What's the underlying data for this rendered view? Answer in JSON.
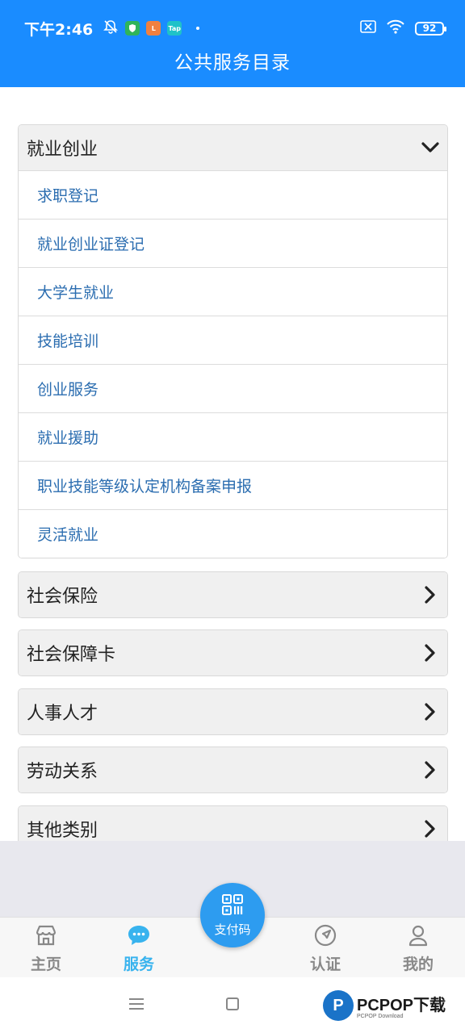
{
  "status_bar": {
    "time": "下午2:46",
    "battery": "92",
    "app_badge_1": "L",
    "app_badge_2": "Tap"
  },
  "header": {
    "title": "公共服务目录"
  },
  "sections": [
    {
      "title": "就业创业",
      "expanded": true,
      "items": [
        "求职登记",
        "就业创业证登记",
        "大学生就业",
        "技能培训",
        "创业服务",
        "就业援助",
        "职业技能等级认定机构备案申报",
        "灵活就业"
      ]
    },
    {
      "title": "社会保险",
      "expanded": false
    },
    {
      "title": "社会保障卡",
      "expanded": false
    },
    {
      "title": "人事人才",
      "expanded": false
    },
    {
      "title": "劳动关系",
      "expanded": false
    },
    {
      "title": "其他类别",
      "expanded": false
    }
  ],
  "tabbar": {
    "home": "主页",
    "service": "服务",
    "pay": "支付码",
    "auth": "认证",
    "mine": "我的"
  },
  "watermark": {
    "main": "PCPOP下载",
    "sub": "PCPOP Download"
  },
  "colors": {
    "header_bg": "#1a8cff",
    "link_text": "#2b6db0",
    "active_tab": "#38b3ee",
    "pay_button": "#2d9cf0"
  }
}
